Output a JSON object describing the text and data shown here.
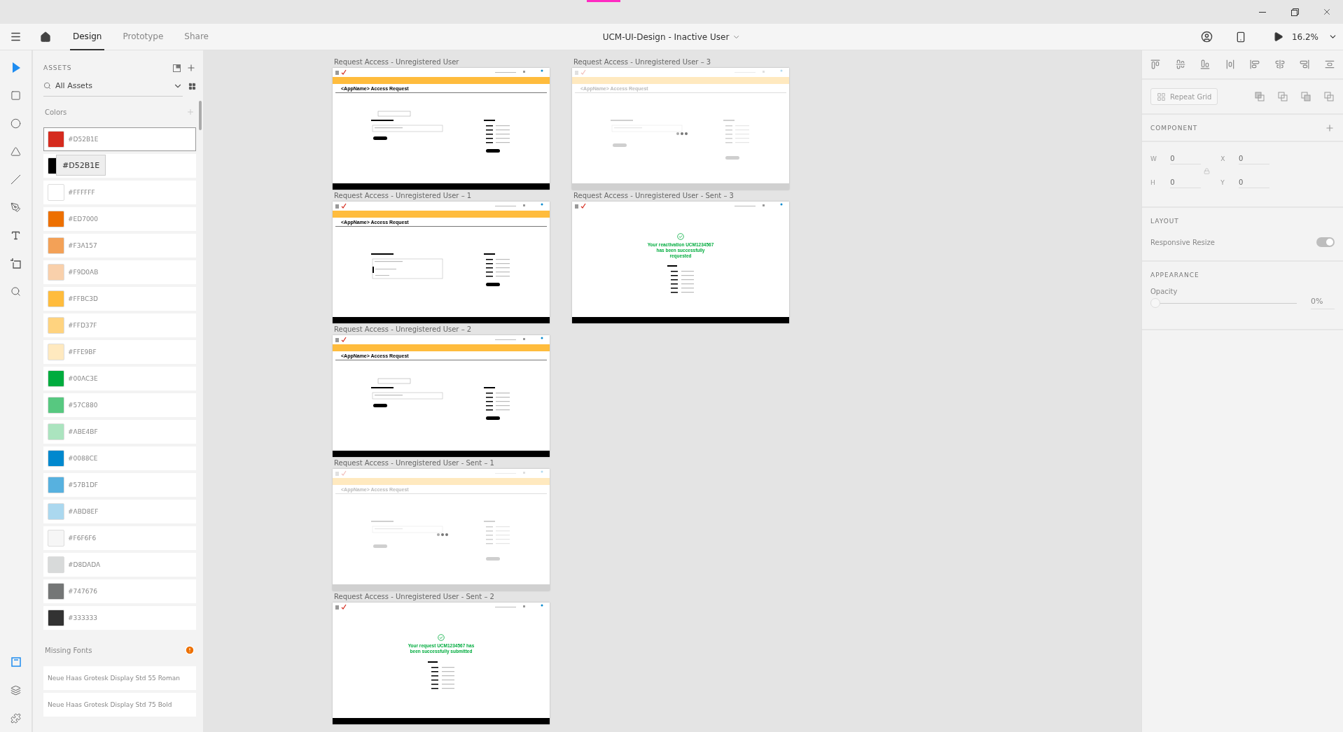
{
  "toolbar": {
    "tabs": [
      {
        "label": "Design",
        "selected": true
      },
      {
        "label": "Prototype",
        "selected": false
      },
      {
        "label": "Share",
        "selected": false
      }
    ],
    "document_title": "UCM-UI-Design - Inactive User",
    "zoom": "16.2%"
  },
  "tools": [
    {
      "kind": "select",
      "selected": true
    },
    {
      "kind": "rectangle",
      "selected": false
    },
    {
      "kind": "ellipse",
      "selected": false
    },
    {
      "kind": "polygon",
      "selected": false
    },
    {
      "kind": "line",
      "selected": false
    },
    {
      "kind": "pen",
      "selected": false
    },
    {
      "kind": "text",
      "selected": false
    },
    {
      "kind": "artboard",
      "selected": false
    },
    {
      "kind": "zoom",
      "selected": false
    }
  ],
  "panel_switcher": [
    {
      "kind": "assets",
      "selected": true
    },
    {
      "kind": "layers",
      "selected": false
    },
    {
      "kind": "plugins",
      "selected": false
    }
  ],
  "assets": {
    "title": "ASSETS",
    "filter": "All Assets",
    "colors_title": "Colors",
    "colors": [
      {
        "label": "#D52B1E",
        "color": "#d52b1e",
        "selected": true
      },
      {
        "color": "#000000",
        "selected": false,
        "tooltip": "#D52B1E"
      },
      {
        "label": "#FFFFFF",
        "color": "#ffffff",
        "selected": false
      },
      {
        "label": "#ED7000",
        "color": "#ed7000",
        "selected": false
      },
      {
        "label": "#F3A157",
        "color": "#f3a157",
        "selected": false
      },
      {
        "label": "#F9D0AB",
        "color": "#f9d0ab",
        "selected": false
      },
      {
        "label": "#FFBC3D",
        "color": "#ffbc3d",
        "selected": false
      },
      {
        "label": "#FFD37F",
        "color": "#ffd37f",
        "selected": false
      },
      {
        "label": "#FFE9BF",
        "color": "#ffe9bf",
        "selected": false
      },
      {
        "label": "#00AC3E",
        "color": "#00ac3e",
        "selected": false
      },
      {
        "label": "#57C880",
        "color": "#57c880",
        "selected": false
      },
      {
        "label": "#ABE4BF",
        "color": "#abe4bf",
        "selected": false
      },
      {
        "label": "#0088CE",
        "color": "#0088ce",
        "selected": false
      },
      {
        "label": "#57B1DF",
        "color": "#57b1df",
        "selected": false
      },
      {
        "label": "#ABD8EF",
        "color": "#abd8ef",
        "selected": false
      },
      {
        "label": "#F6F6F6",
        "color": "#f6f6f6",
        "selected": false
      },
      {
        "label": "#D8DADA",
        "color": "#d8dada",
        "selected": false
      },
      {
        "label": "#747676",
        "color": "#747676",
        "selected": false
      },
      {
        "label": "#333333",
        "color": "#333333",
        "selected": false
      }
    ],
    "missing_fonts_title": "Missing Fonts",
    "missing_fonts": [
      "Neue Haas Grotesk Display Std 55 Roman",
      "Neue Haas Grotesk Display Std 75 Bold"
    ]
  },
  "canvas": {
    "columns": [
      [
        {
          "title": "Request Access - Unregistered User",
          "kind": "form",
          "heading": "<AppName> Access Request"
        },
        {
          "title": "Request Access - Unregistered User – 1",
          "kind": "dropdown",
          "heading": "<AppName> Access Request"
        },
        {
          "title": "Request Access - Unregistered User – 2",
          "kind": "form",
          "heading": "<AppName> Access Request"
        },
        {
          "title": "Request Access - Unregistered User - Sent – 1",
          "kind": "loading",
          "heading": "<AppName> Access Request"
        },
        {
          "title": "Request Access - Unregistered User - Sent – 2",
          "kind": "success",
          "message": "Your request UCM1234567 has been successfully submitted"
        }
      ],
      [
        {
          "title": "Request Access - Unregistered User – 3",
          "kind": "loading",
          "heading": "<AppName> Access Request"
        },
        {
          "title": "Request Access - Unregistered User - Sent – 3",
          "kind": "success",
          "message": "Your reactivation UCM1234567 has been successfully requested"
        }
      ]
    ]
  },
  "properties": {
    "repeat_grid": "Repeat Grid",
    "component_title": "COMPONENT",
    "fields": [
      {
        "label": "W",
        "value": "0"
      },
      {
        "label": "X",
        "value": "0"
      },
      {
        "label": "H",
        "value": "0"
      },
      {
        "label": "Y",
        "value": "0"
      }
    ],
    "layout_title": "LAYOUT",
    "responsive_resize": {
      "label": "Responsive Resize",
      "on": true
    },
    "appearance_title": "APPEARANCE",
    "opacity": {
      "label": "Opacity",
      "level": 0,
      "reading": "0%"
    }
  }
}
